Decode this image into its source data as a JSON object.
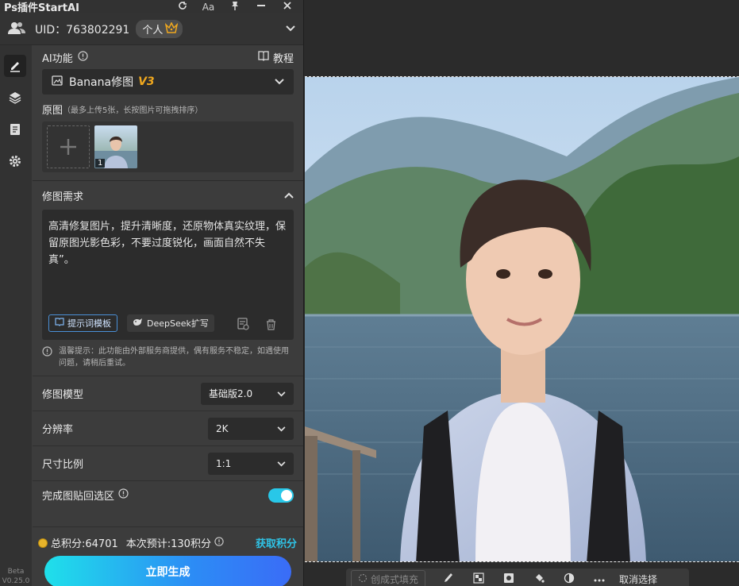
{
  "app": {
    "title": "Ps插件StartAI"
  },
  "titlebar": {
    "icons": [
      "refresh-icon",
      "font-size-icon",
      "pin-icon",
      "minimize-icon",
      "close-icon"
    ],
    "font_label": "Aa"
  },
  "user": {
    "uid_label": "UID：763802291",
    "badge_label": "个人"
  },
  "ai": {
    "label": "AI功能",
    "tutorial": "教程",
    "feature": "Banana修图",
    "feature_version": "V3"
  },
  "source": {
    "label": "原图",
    "hint": "（最多上传5张，长按图片可拖拽排序）",
    "thumb_index": "1"
  },
  "request": {
    "label": "修图需求",
    "text": "高清修复图片，提升清晰度，还原物体真实纹理，保留原图光影色彩，不要过度锐化，画面自然不失真”。",
    "template_btn": "提示词模板",
    "deepseek_btn": "DeepSeek扩写"
  },
  "notice": {
    "text": "温馨提示：此功能由外部服务商提供，偶有服务不稳定，如遇使用问题，请稍后重试。"
  },
  "options": {
    "model_label": "修图模型",
    "model_value": "基础版2.0",
    "resolution_label": "分辨率",
    "resolution_value": "2K",
    "ratio_label": "尺寸比例",
    "ratio_value": "1:1",
    "paste_label": "完成图贴回选区",
    "paste_on": true
  },
  "footer": {
    "total_points": "总积分:64701",
    "estimate": "本次预计:130积分",
    "get_points": "获取积分",
    "generate": "立即生成"
  },
  "version": {
    "beta": "Beta",
    "num": "V0.25.0"
  },
  "canvas_toolbar": {
    "fill_label": "创成式填充",
    "deselect": "取消选择"
  },
  "colors": {
    "accent": "#28c7e8",
    "brand_orange": "#f0a81e",
    "panel_bg": "#3c3c3c"
  }
}
